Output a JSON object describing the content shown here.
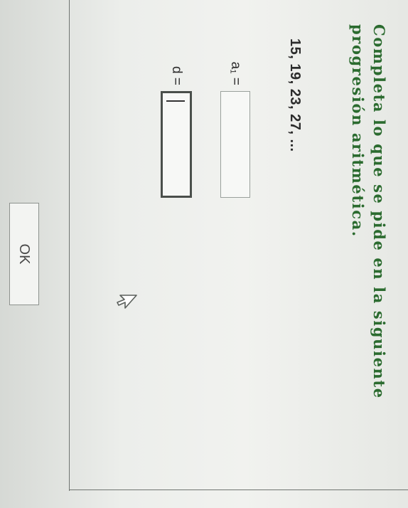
{
  "question": {
    "instruction": "Completa lo que se pide en la siguiente progresión aritmética.",
    "sequence": "15, 19, 23, 27, ...",
    "fields": {
      "a1_label": "a₁ =",
      "a1_value": "",
      "d_label": "d =",
      "d_value": ""
    }
  },
  "actions": {
    "ok_label": "OK"
  },
  "icons": {
    "pointer": "mouse-pointer-icon"
  },
  "colors": {
    "instruction_text": "#2b6b2f",
    "background": "#eceeeb"
  }
}
